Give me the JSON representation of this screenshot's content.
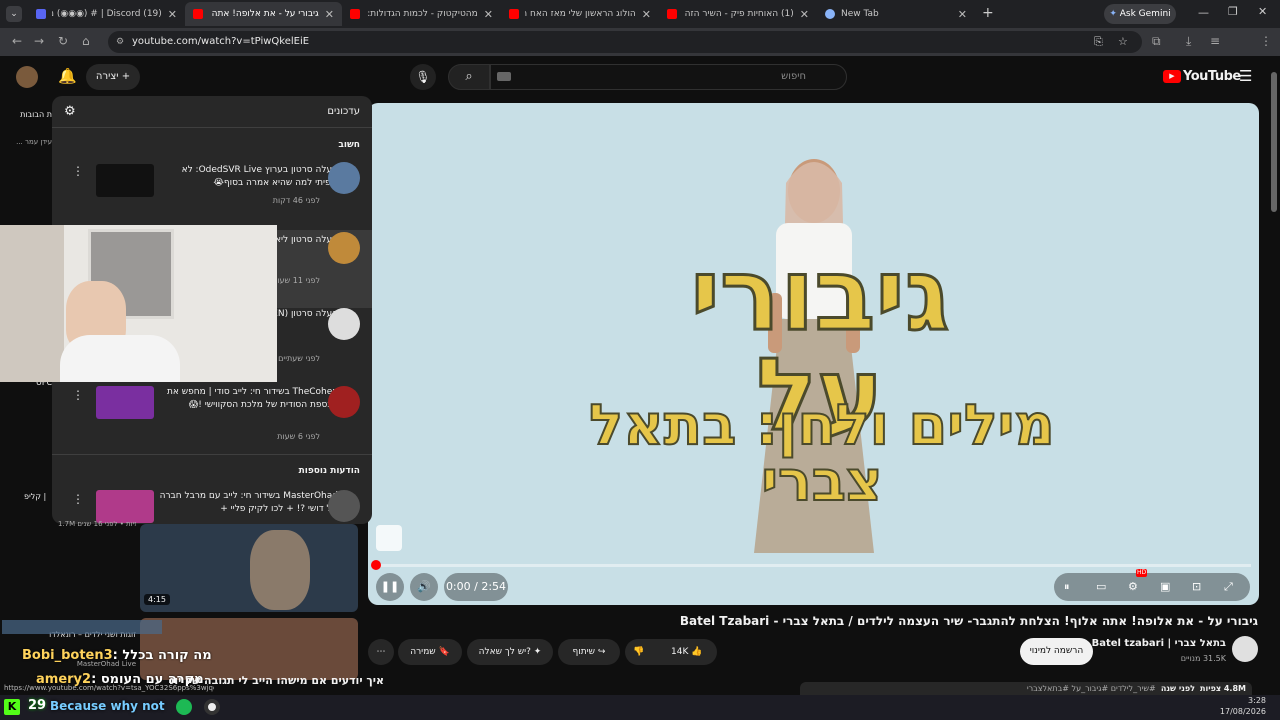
{
  "browser": {
    "tabs": [
      {
        "title": "(19) Discord | #‏ (◉◉◉) מיסט & ג",
        "color": "#5865f2"
      },
      {
        "title": "גיבורי על - את אלופה! אתה",
        "color": "#ff0000",
        "active": true
      },
      {
        "title": "מהטיקטוק - לכמות הגדולות: הע",
        "color": "#ff0000"
      },
      {
        "title": "הולוג הראשון שלי מאז האח הגד",
        "color": "#ff0000"
      },
      {
        "title": "(1) האוחיות פיק - השיר הזה - בו",
        "color": "#ff0000"
      },
      {
        "title": "New Tab",
        "color": "#8ab4f8"
      }
    ],
    "ask_gemini": "Ask Gemini",
    "url": "youtube.com/watch?v=tPiwQkelEiE"
  },
  "youtube": {
    "logo_text": "YouTube",
    "search_placeholder": "חיפוש",
    "create_label": "יצירה",
    "notifications": {
      "title": "עדכונים",
      "section_important": "חשוב",
      "section_more": "הודעות נוספות",
      "items": [
        {
          "text": "העלה סרטון בערוץ OdedSVR Live: לא ציפיתי למה שהיא אמרה בסוף😭",
          "time": "לפני 46 דקות"
        },
        {
          "text": "העלה סרטון ליאור סורק ניסים | רון",
          "time": "לפני 11 שעות"
        },
        {
          "text": "העלה סרטון LIFE (FT. SIDEMEN)",
          "time": "לפני שעתיים"
        },
        {
          "text": "TheCohen בשידור חי: לייב סודי | מחפש את הכספת הסודית של מלכת הסקווישי !😱",
          "time": "לפני 6 שעות"
        },
        {
          "text": "MasterOhad בשידור חי: לייב עם מרבל חברה של דושי ?! + לכו לקיק פליי +",
          "time": ""
        }
      ]
    },
    "video": {
      "overlay_title": "גיבורי על",
      "overlay_subtitle": "מילים ולחן: בתאל צברי",
      "time": "0:00 / 2:54",
      "progress": 0.0,
      "hd_badge": "HD"
    },
    "info": {
      "title": "גיבורי על - את אלופה! אתה אלוף! הצלחת להתגבר- שיר העצמה לילדים / בתאל צברי - Batel Tzabari",
      "channel": "בתאל צברי | Batel tzabari",
      "subs": "31.5K מנויים",
      "subscribe": "הרשמה למינוי",
      "likes": "14K",
      "share": "שיתוף",
      "ask": "יש לך שאלה?",
      "save": "שמירה",
      "views": "4.8M צפיות",
      "date": "לפני שנה",
      "tags": "#שיר_לילדים #גיבור_על #בתאלצברי"
    },
    "sidebar": {
      "label1": "ת הבובות",
      "label2": "... עידן עמר",
      "label3": "UFC",
      "label4": "| קליפ",
      "rec_meta": "1.7M צפיות • לפני 16 שנים",
      "rec_duration": "4:15",
      "rec2_title": "זוגות ושני ילדים – רונאלדו",
      "rec2_channel": "MasterOhad Live",
      "rec3_title": "איך יודעים אם מישהו הייב לי תגובה של יוטיוב...",
      "rec3_url": "https://www.youtube.com/watch?v=tsa_YOC32S6pps%3wjqcuGOOkXgF"
    }
  },
  "chat_overlay": {
    "line1": "Bobi_boten3",
    "line1_msg": ": מה קורה בכלל",
    "line2": "amery2",
    "line2_msg": ": מקרה עם העומס",
    "line3": "Because why not",
    "emote_count": "29"
  },
  "taskbar": {
    "time": "3:28",
    "date": "17/08/2026"
  }
}
